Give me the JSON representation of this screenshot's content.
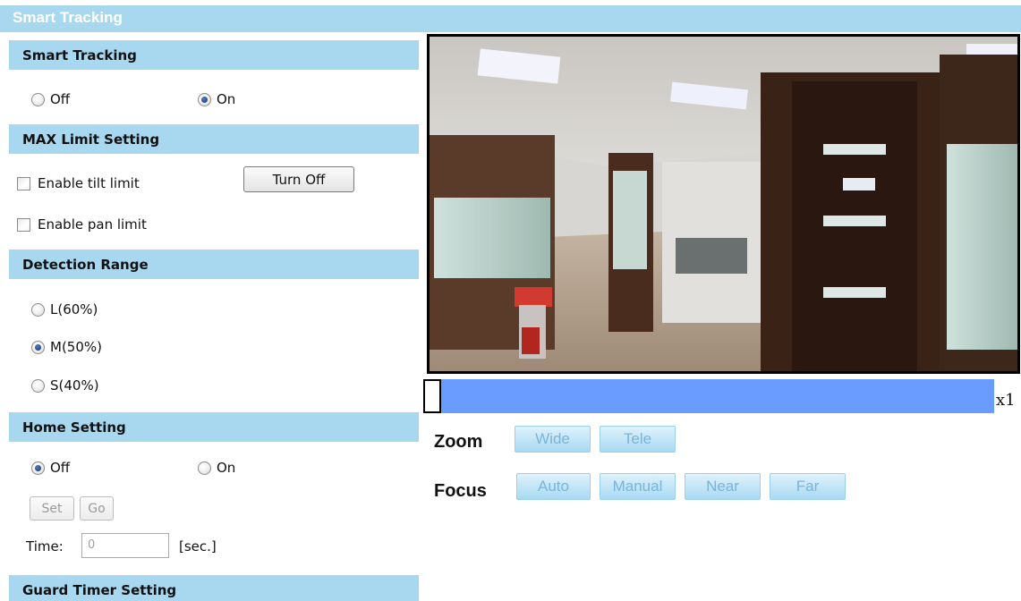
{
  "page_title": "Smart Tracking",
  "sections": {
    "smart_tracking": "Smart Tracking",
    "max_limit": "MAX Limit Setting",
    "detection_range": "Detection Range",
    "home_setting": "Home Setting",
    "guard_timer": "Guard Timer Setting"
  },
  "smart_tracking": {
    "options": [
      {
        "label": "Off",
        "checked": false
      },
      {
        "label": "On",
        "checked": true
      }
    ]
  },
  "max_limit": {
    "tilt_label": "Enable tilt limit",
    "tilt_checked": false,
    "pan_label": "Enable pan limit",
    "pan_checked": false,
    "turn_off_label": "Turn Off"
  },
  "detection_range": {
    "options": [
      {
        "label": "L(60%)",
        "checked": false
      },
      {
        "label": "M(50%)",
        "checked": true
      },
      {
        "label": "S(40%)",
        "checked": false
      }
    ]
  },
  "home_setting": {
    "options": [
      {
        "label": "Off",
        "checked": true
      },
      {
        "label": "On",
        "checked": false
      }
    ],
    "set_label": "Set",
    "go_label": "Go",
    "time_label": "Time:",
    "time_value": "0",
    "time_unit": "[sec.]"
  },
  "zoom": {
    "multiplier": "x1",
    "label": "Zoom",
    "wide": "Wide",
    "tele": "Tele"
  },
  "focus": {
    "label": "Focus",
    "auto": "Auto",
    "manual": "Manual",
    "near": "Near",
    "far": "Far"
  },
  "colors": {
    "section_bg": "#a8d8f0",
    "zoom_bar": "#6a9cff",
    "control_button": "#a9d9f3"
  }
}
